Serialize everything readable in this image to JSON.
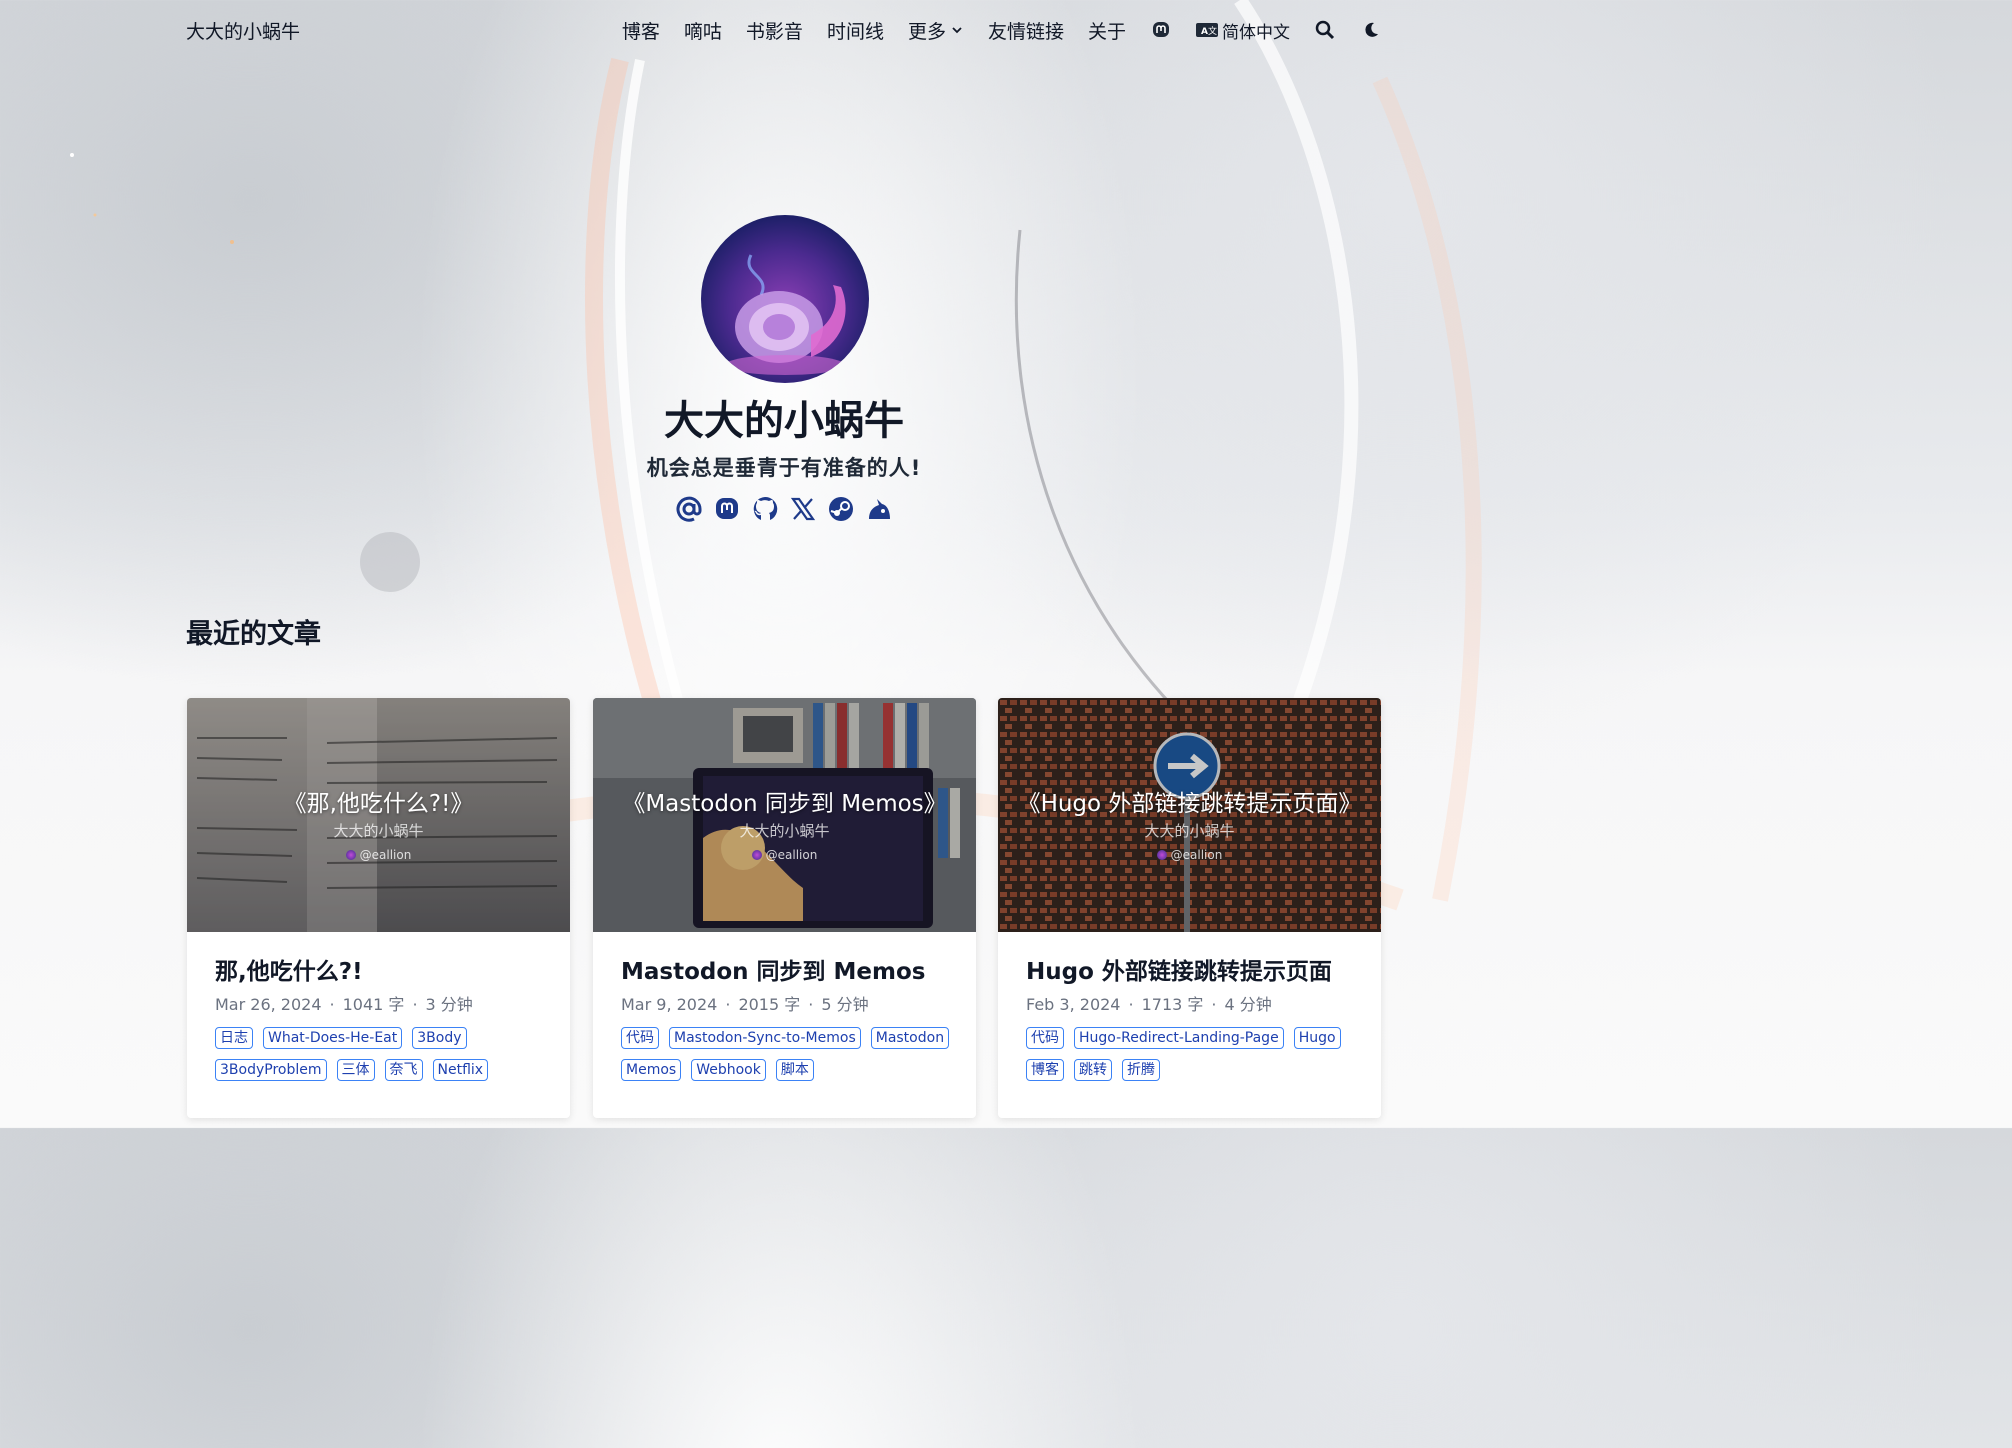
{
  "header": {
    "site_title": "大大的小蜗牛",
    "nav": [
      {
        "label": "博客"
      },
      {
        "label": "嘀咕"
      },
      {
        "label": "书影音"
      },
      {
        "label": "时间线"
      },
      {
        "label": "更多"
      },
      {
        "label": "友情链接"
      },
      {
        "label": "关于"
      }
    ],
    "language_label": "简体中文",
    "language_badge": "A",
    "icons": [
      "mastodon-icon",
      "translate-icon",
      "search-icon",
      "moon-icon"
    ]
  },
  "profile": {
    "name": "大大的小蜗牛",
    "tagline": "机会总是垂青于有准备的人!",
    "socials": [
      "email-icon",
      "mastodon-icon",
      "github-icon",
      "x-icon",
      "steam-icon",
      "blog-icon"
    ]
  },
  "section_title": "最近的文章",
  "posts": [
    {
      "image_title": "《那,他吃什么?!》",
      "image_author": "大大的小蜗牛",
      "image_handle": "@eallion",
      "title": "那,他吃什么?!",
      "date": "Mar 26, 2024",
      "words": "1041 字",
      "read_time": "3 分钟",
      "tags": [
        "日志",
        "What-Does-He-Eat",
        "3Body",
        "3BodyProblem",
        "三体",
        "奈飞",
        "Netflix"
      ]
    },
    {
      "image_title": "《Mastodon 同步到 Memos》",
      "image_author": "大大的小蜗牛",
      "image_handle": "@eallion",
      "title": "Mastodon 同步到 Memos",
      "date": "Mar 9, 2024",
      "words": "2015 字",
      "read_time": "5 分钟",
      "tags": [
        "代码",
        "Mastodon-Sync-to-Memos",
        "Mastodon",
        "Memos",
        "Webhook",
        "脚本"
      ]
    },
    {
      "image_title": "《Hugo 外部链接跳转提示页面》",
      "image_author": "大大的小蜗牛",
      "image_handle": "@eallion",
      "title": "Hugo 外部链接跳转提示页面",
      "date": "Feb 3, 2024",
      "words": "1713 字",
      "read_time": "4 分钟",
      "tags": [
        "代码",
        "Hugo-Redirect-Landing-Page",
        "Hugo",
        "博客",
        "跳转",
        "折腾"
      ]
    }
  ],
  "colors": {
    "tag_border": "#3b82f6",
    "tag_text": "#1e40af",
    "social_icon": "#1e3a8a"
  }
}
